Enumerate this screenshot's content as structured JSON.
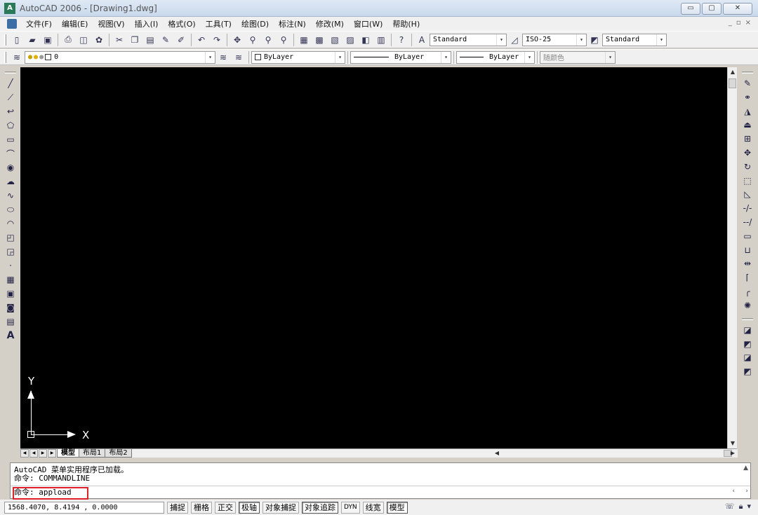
{
  "window": {
    "title": "AutoCAD 2006 - [Drawing1.dwg]",
    "app_icon_text": "A",
    "controls": {
      "minimize": "▭",
      "maximize": "▢",
      "close": "✕"
    }
  },
  "menu": {
    "items": [
      "文件(F)",
      "编辑(E)",
      "视图(V)",
      "插入(I)",
      "格式(O)",
      "工具(T)",
      "绘图(D)",
      "标注(N)",
      "修改(M)",
      "窗口(W)",
      "帮助(H)"
    ]
  },
  "toolbar_standard": {
    "text_style": "Standard",
    "dim_style": "ISO-25",
    "table_style": "Standard"
  },
  "toolbar_layers": {
    "layer_name": "0",
    "color": "ByLayer",
    "linetype": "ByLayer",
    "lineweight": "ByLayer",
    "plot_style": "随颜色"
  },
  "canvas": {
    "background": "#000000",
    "ucs_x_label": "X",
    "ucs_y_label": "Y"
  },
  "layout_tabs": [
    "模型",
    "布局1",
    "布局2"
  ],
  "active_tab": "模型",
  "command_window": {
    "history": [
      "AutoCAD 菜单实用程序已加载。",
      "命令: COMMANDLINE"
    ],
    "current": "命令: appload"
  },
  "status_bar": {
    "coordinates": "1568.4070, 8.4194 , 0.0000",
    "buttons": [
      {
        "label": "捕捉",
        "on": false
      },
      {
        "label": "栅格",
        "on": false
      },
      {
        "label": "正交",
        "on": false
      },
      {
        "label": "极轴",
        "on": true
      },
      {
        "label": "对象捕捉",
        "on": false
      },
      {
        "label": "对象追踪",
        "on": true
      },
      {
        "label": "DYN",
        "on": false
      },
      {
        "label": "线宽",
        "on": false
      },
      {
        "label": "模型",
        "on": true
      }
    ]
  },
  "colors": {
    "highlight_box": "#e0202a",
    "canvas": "#000000"
  }
}
